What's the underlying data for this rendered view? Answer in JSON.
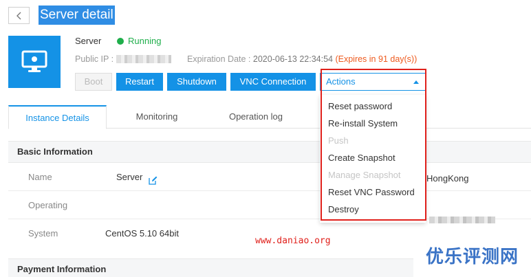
{
  "header": {
    "title": "Server detail"
  },
  "server": {
    "name": "Server",
    "status": "Running",
    "public_ip_label": "Public IP :",
    "expiration_label": "Expiration Date :",
    "expiration_date": "2020-06-13 22:34:54",
    "expires_note": "(Expires in 91 day(s))"
  },
  "toolbar": {
    "boot_label": "Boot",
    "restart_label": "Restart",
    "shutdown_label": "Shutdown",
    "vnc_label": "VNC Connection",
    "actions_label": "Actions"
  },
  "actions_menu": {
    "items": [
      {
        "label": "Reset password",
        "disabled": false
      },
      {
        "label": "Re-install System",
        "disabled": false
      },
      {
        "label": "Push",
        "disabled": true
      },
      {
        "label": "Create Snapshot",
        "disabled": false
      },
      {
        "label": "Manage Snapshot",
        "disabled": true
      },
      {
        "label": "Reset VNC Password",
        "disabled": false
      },
      {
        "label": "Destroy",
        "disabled": false
      }
    ]
  },
  "tabs": [
    {
      "label": "Instance Details"
    },
    {
      "label": "Monitoring"
    },
    {
      "label": "Operation log"
    }
  ],
  "basic_info": {
    "section_title": "Basic Information",
    "rows": [
      {
        "label": "Name",
        "value": "Server"
      },
      {
        "label": "Operating",
        "value": ""
      },
      {
        "label": "System",
        "value": "CentOS 5.10 64bit"
      }
    ],
    "region_value": "HongKong"
  },
  "payment_info": {
    "section_title": "Payment Information"
  },
  "watermark": {
    "url": "www.daniao.org",
    "logo_text": "优乐评测网"
  },
  "colors": {
    "primary": "#1492e6",
    "running": "#1fae4b",
    "warning": "#ee5a1e",
    "highlight": "#e0201b"
  }
}
